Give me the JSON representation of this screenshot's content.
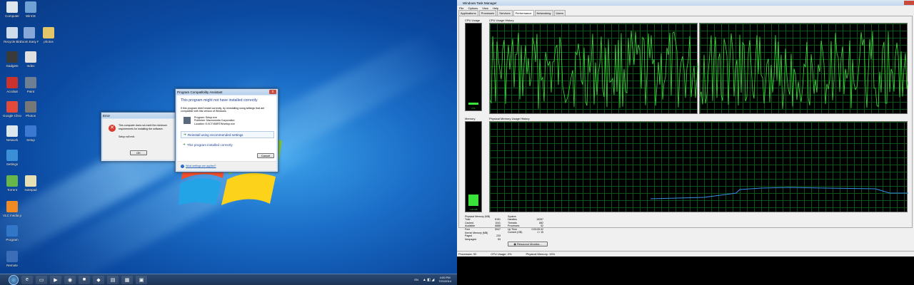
{
  "desktop": {
    "icons": [
      {
        "label": "Computer",
        "color": "#dfe7ee"
      },
      {
        "label": "WinCE",
        "color": "#6fa1d4"
      },
      {
        "label": "Recycle Bin",
        "color": "#cfdceb"
      },
      {
        "label": "Zoom Easy Photo",
        "color": "#88a7d9"
      },
      {
        "label": "photos",
        "color": "#e3c66a"
      },
      {
        "label": "Gadgets",
        "color": "#3a3a3a"
      },
      {
        "label": "Index",
        "color": "#e0e0e0"
      },
      {
        "label": "Acrobat",
        "color": "#c9322d"
      },
      {
        "label": "Paint",
        "color": "#6e7f93"
      },
      {
        "label": "Google Chrome",
        "color": "#e34a39"
      },
      {
        "label": "Photos",
        "color": "#777"
      },
      {
        "label": "Network",
        "color": "#dfe7ee"
      },
      {
        "label": "Setup",
        "color": "#3b78d2"
      },
      {
        "label": "Settings",
        "color": "#3a8fd6"
      },
      {
        "label": "Torrent",
        "color": "#68b54a"
      },
      {
        "label": "Notepad",
        "color": "#e6dfb4"
      },
      {
        "label": "VLC media player",
        "color": "#f08a24"
      },
      {
        "label": "Program",
        "color": "#3176c7"
      },
      {
        "label": "Remote",
        "color": "#3c6db8"
      }
    ]
  },
  "error_dialog": {
    "title": "Error",
    "message": "This computer does not meet the minimum requirements for installing the software.",
    "sub": "Setup will exit.",
    "ok_label": "OK"
  },
  "pca_dialog": {
    "title": "Program Compatibility Assistant",
    "heading": "This program might not have installed correctly",
    "description": "If this program didn't install correctly, try reinstalling using settings that are compatible with this version of Windows.",
    "program_name": "Program: Setup.exe",
    "publisher": "Publisher: Macromedia Corporation",
    "location": "Location: E:\\ICT\\SMRTW\\setup.exe",
    "option_reinstall": "Reinstall using recommended settings",
    "option_ok": "This program installed correctly",
    "cancel_label": "Cancel",
    "help_link": "What settings are applied?"
  },
  "taskbar": {
    "time": "4:00 PM",
    "date": "7/21/2014",
    "lang": "EN"
  },
  "task_manager": {
    "title": "Windows Task Manager",
    "menu": [
      "File",
      "Options",
      "View",
      "Help"
    ],
    "tabs": [
      "Applications",
      "Processes",
      "Services",
      "Performance",
      "Networking",
      "Users"
    ],
    "active_tab": "Performance",
    "cpu_usage_label": "CPU Usage",
    "cpu_history_label": "CPU Usage History",
    "memory_label": "Memory",
    "memory_history_label": "Physical Memory Usage History",
    "memory_bar_value": "1.20 GB",
    "cpu_bar_value": "2 %",
    "physical_memory": {
      "heading": "Physical Memory (MB)",
      "rows": [
        [
          "Total",
          "8151"
        ],
        [
          "Cached",
          "1041"
        ],
        [
          "Available",
          "6888"
        ],
        [
          "Free",
          "5947"
        ]
      ]
    },
    "kernel_memory": {
      "heading": "Kernel Memory (MB)",
      "rows": [
        [
          "Paged",
          "233"
        ],
        [
          "Nonpaged",
          "53"
        ]
      ]
    },
    "system": {
      "heading": "System",
      "rows": [
        [
          "Handles",
          "15267"
        ],
        [
          "Threads",
          "682"
        ],
        [
          "Processes",
          "52"
        ],
        [
          "Up Time",
          "0:00:05:32"
        ],
        [
          "Commit (GB)",
          "1 / 15"
        ]
      ]
    },
    "resource_monitor_label": "Resource Monitor...",
    "status": {
      "processes": "Processes: 52",
      "cpu": "CPU Usage: 2%",
      "memory": "Physical Memory: 15%"
    }
  }
}
